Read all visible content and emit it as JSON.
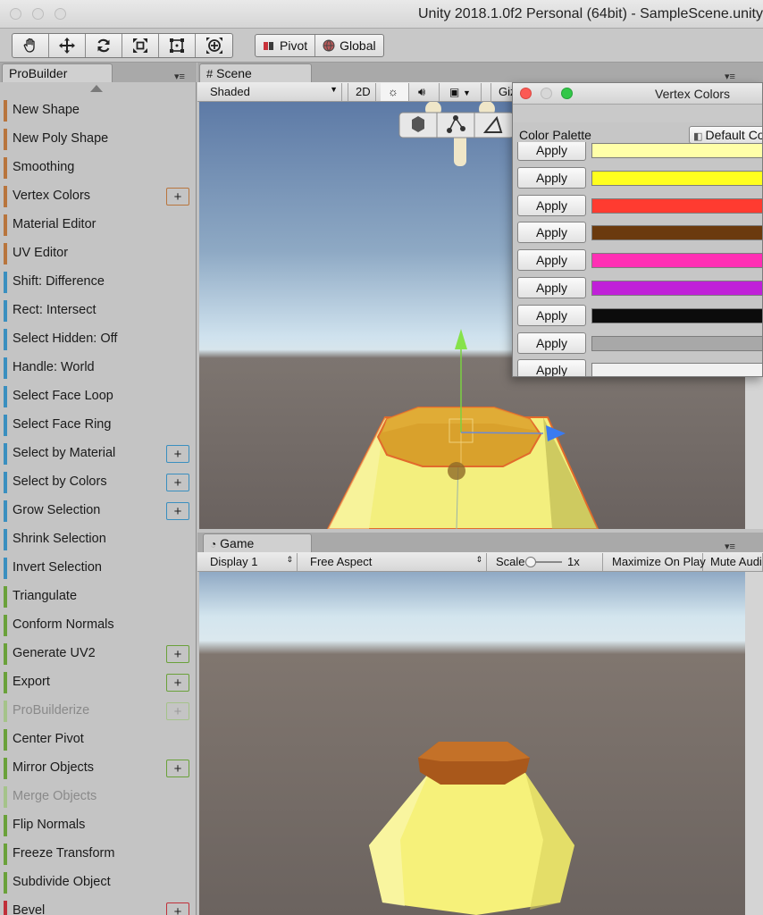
{
  "window": {
    "title": "Unity 2018.1.0f2 Personal (64bit) - SampleScene.unity"
  },
  "toolbar": {
    "tools": [
      "hand-icon",
      "move-icon",
      "rotate-icon",
      "scale-icon",
      "rect-tool-icon",
      "transform-tool-icon"
    ],
    "pivot_label": "Pivot",
    "global_label": "Global"
  },
  "probuilder": {
    "tab_label": "ProBuilder",
    "items": [
      {
        "label": "New Shape",
        "color": "#b8753d",
        "plus": false,
        "disabled": false
      },
      {
        "label": "New Poly Shape",
        "color": "#b8753d",
        "plus": false,
        "disabled": false
      },
      {
        "label": "Smoothing",
        "color": "#b8753d",
        "plus": false,
        "disabled": false
      },
      {
        "label": "Vertex Colors",
        "color": "#b8753d",
        "plus": true,
        "disabled": false
      },
      {
        "label": "Material Editor",
        "color": "#b8753d",
        "plus": false,
        "disabled": false
      },
      {
        "label": "UV Editor",
        "color": "#b8753d",
        "plus": false,
        "disabled": false
      },
      {
        "label": "Shift: Difference",
        "color": "#3a8fbf",
        "plus": false,
        "disabled": false
      },
      {
        "label": "Rect: Intersect",
        "color": "#3a8fbf",
        "plus": false,
        "disabled": false
      },
      {
        "label": "Select Hidden: Off",
        "color": "#3a8fbf",
        "plus": false,
        "disabled": false
      },
      {
        "label": "Handle: World",
        "color": "#3a8fbf",
        "plus": false,
        "disabled": false
      },
      {
        "label": "Select Face Loop",
        "color": "#3a8fbf",
        "plus": false,
        "disabled": false
      },
      {
        "label": "Select Face Ring",
        "color": "#3a8fbf",
        "plus": false,
        "disabled": false
      },
      {
        "label": "Select by Material",
        "color": "#3a8fbf",
        "plus": true,
        "disabled": false
      },
      {
        "label": "Select by Colors",
        "color": "#3a8fbf",
        "plus": true,
        "disabled": false
      },
      {
        "label": "Grow Selection",
        "color": "#3a8fbf",
        "plus": true,
        "disabled": false
      },
      {
        "label": "Shrink Selection",
        "color": "#3a8fbf",
        "plus": false,
        "disabled": false
      },
      {
        "label": "Invert Selection",
        "color": "#3a8fbf",
        "plus": false,
        "disabled": false
      },
      {
        "label": "Triangulate",
        "color": "#6aa13a",
        "plus": false,
        "disabled": false
      },
      {
        "label": "Conform Normals",
        "color": "#6aa13a",
        "plus": false,
        "disabled": false
      },
      {
        "label": "Generate UV2",
        "color": "#6aa13a",
        "plus": true,
        "disabled": false
      },
      {
        "label": "Export",
        "color": "#6aa13a",
        "plus": true,
        "disabled": false
      },
      {
        "label": "ProBuilderize",
        "color": "#a5c38a",
        "plus": true,
        "disabled": true
      },
      {
        "label": "Center Pivot",
        "color": "#6aa13a",
        "plus": false,
        "disabled": false
      },
      {
        "label": "Mirror Objects",
        "color": "#6aa13a",
        "plus": true,
        "disabled": false
      },
      {
        "label": "Merge Objects",
        "color": "#a5c38a",
        "plus": false,
        "disabled": true
      },
      {
        "label": "Flip Normals",
        "color": "#6aa13a",
        "plus": false,
        "disabled": false
      },
      {
        "label": "Freeze Transform",
        "color": "#6aa13a",
        "plus": false,
        "disabled": false
      },
      {
        "label": "Subdivide Object",
        "color": "#6aa13a",
        "plus": false,
        "disabled": false
      },
      {
        "label": "Bevel",
        "color": "#c0303a",
        "plus": true,
        "disabled": false
      }
    ]
  },
  "scene": {
    "tab_label": "Scene",
    "shading_mode": "Shaded",
    "mode_2d": "2D",
    "gizmos_label": "Gizmos"
  },
  "game": {
    "tab_label": "Game",
    "display": "Display 1",
    "aspect": "Free Aspect",
    "scale_label": "Scale",
    "scale_value": "1x",
    "maximize": "Maximize On Play",
    "mute": "Mute Audio"
  },
  "vertex_colors": {
    "title": "Vertex Colors",
    "palette_label": "Color Palette",
    "palette_value": "Default Color Palette",
    "apply_label": "Apply",
    "colors": [
      "#ffffa8",
      "#ffff1e",
      "#ff3b30",
      "#6b3a0e",
      "#ff2fb4",
      "#c020d8",
      "#0c0c0c",
      "#a8a8a8",
      "#f1f1f1"
    ]
  }
}
